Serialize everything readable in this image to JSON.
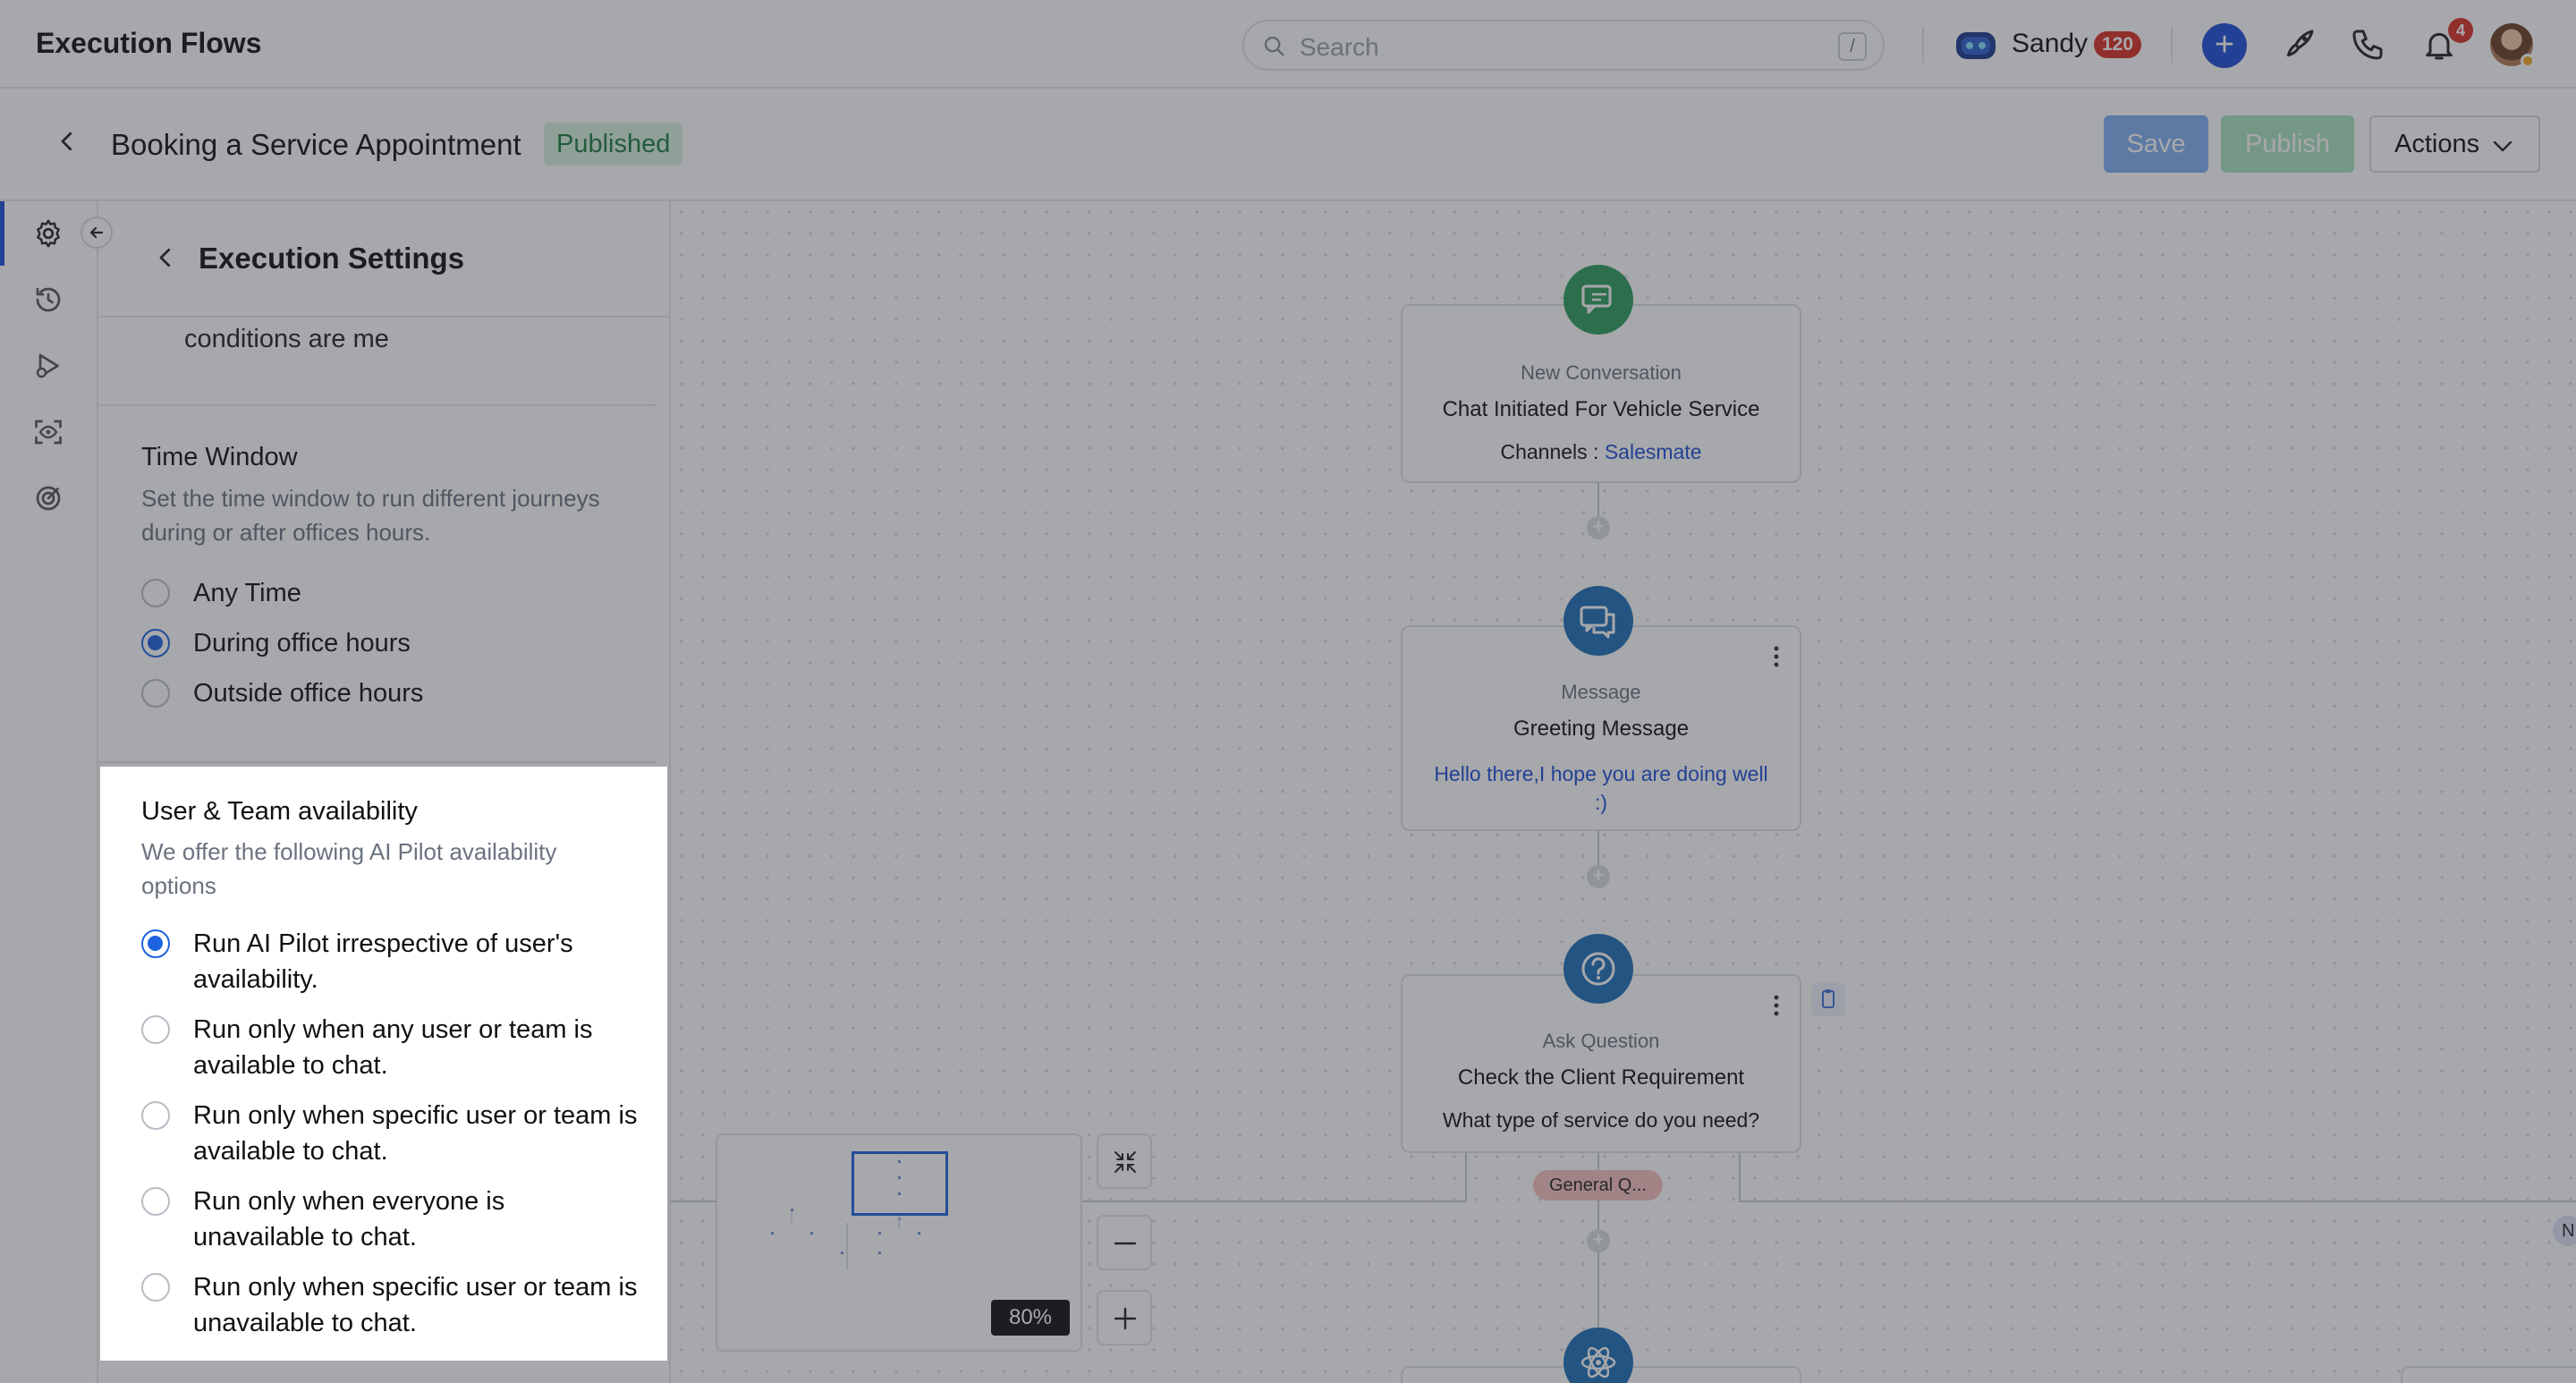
{
  "app": {
    "title": "Execution Flows"
  },
  "search": {
    "placeholder": "Search",
    "shortcut": "/"
  },
  "user": {
    "name": "Sandy",
    "count": "120"
  },
  "notifications": {
    "count": "4"
  },
  "flow": {
    "title": "Booking a Service Appointment",
    "status": "Published"
  },
  "header_buttons": {
    "save": "Save",
    "publish": "Publish",
    "actions": "Actions"
  },
  "colors": {
    "accent": "#1d4fd8",
    "published_bg": "#d6f1df",
    "published_text": "#1e7a40",
    "node_green": "#2e9d5c",
    "node_blue": "#1d6fb8"
  },
  "rail": {
    "items": [
      "gear-icon",
      "history-icon",
      "play-icon",
      "scan-eye-icon",
      "target-icon"
    ]
  },
  "panel": {
    "title": "Execution Settings",
    "prev_text": "conditions are me",
    "time_window": {
      "title": "Time Window",
      "description": "Set the time window to run different journeys during or after offices hours.",
      "options": [
        {
          "label": "Any Time",
          "checked": false
        },
        {
          "label": "During office hours",
          "checked": true
        },
        {
          "label": "Outside office hours",
          "checked": false
        }
      ]
    },
    "availability": {
      "title": "User & Team availability",
      "description": "We offer the following AI Pilot availability options",
      "options": [
        {
          "label": "Run AI Pilot irrespective of user's availability.",
          "checked": true
        },
        {
          "label": "Run only when any user or team is available to chat.",
          "checked": false
        },
        {
          "label": "Run only when specific user or team is available to chat.",
          "checked": false
        },
        {
          "label": "Run only when everyone is unavailable to chat.",
          "checked": false
        },
        {
          "label": "Run only when specific user or team is unavailable to chat.",
          "checked": false
        }
      ]
    }
  },
  "nodes": [
    {
      "type": "New Conversation",
      "name": "Chat Initiated For Vehicle Service",
      "detail_label": "Channels :",
      "detail_value": "Salesmate"
    },
    {
      "type": "Message",
      "name": "Greeting Message",
      "detail_value": "Hello there,I hope you are doing well :)"
    },
    {
      "type": "Ask Question",
      "name": "Check the Client Requirement",
      "detail_value": "What type of service do you need?"
    }
  ],
  "branches": {
    "left": "General Q...",
    "right": "N"
  },
  "canvas": {
    "zoom": "80%"
  }
}
